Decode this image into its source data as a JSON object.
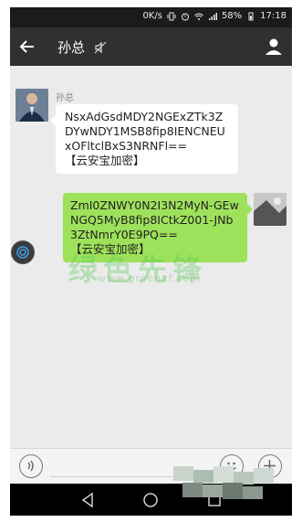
{
  "status_bar": {
    "speed": "0K/s",
    "battery": "58%",
    "time": "17:18"
  },
  "header": {
    "title": "孙总"
  },
  "messages": [
    {
      "side": "left",
      "sender": "孙总",
      "text": "NsxAdGsdMDY2NGExZTk3ZDYwNDY1MSB8fip8IENCNEUxOFltclBxS3NRNFl==",
      "tag": "【云安宝加密】"
    },
    {
      "side": "right",
      "text": "ZmI0ZNWY0N2I3N2MyN-GEwNGQ5MyB8fip8ICtkZ001-JNb3ZtNmrY0E9PQ==",
      "tag": "【云安宝加密】"
    }
  ],
  "watermark": {
    "main": "绿色先锋",
    "sub": "www.greenxf.com"
  },
  "colors": {
    "header_bg": "#303030",
    "status_bg": "#1b1b1b",
    "chat_bg": "#ebebeb",
    "sent_bubble": "#9ee15b",
    "received_bubble": "#ffffff"
  },
  "icons": {
    "back": "back-arrow-icon",
    "mute": "mute-icon",
    "profile": "person-icon",
    "voice": "voice-icon",
    "emoji": "emoji-icon",
    "plus": "plus-icon",
    "nav_back": "triangle-back-icon",
    "nav_home": "circle-home-icon",
    "nav_recent": "square-recent-icon",
    "floating": "fingerprint-icon"
  }
}
